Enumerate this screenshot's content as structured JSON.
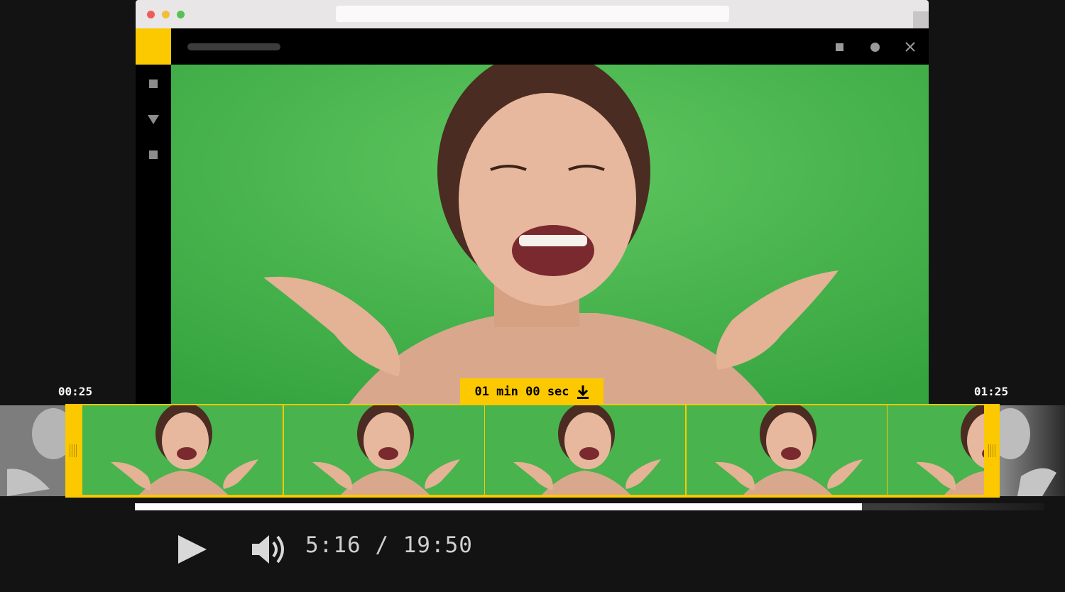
{
  "window": {
    "controls": [
      "close-dot",
      "minimize-dot",
      "maximize-dot"
    ]
  },
  "colors": {
    "accent": "#fcc800",
    "green_screen": "#3fb04a",
    "background": "#131313"
  },
  "timeline": {
    "start_time": "00:25",
    "end_time": "01:25",
    "clip_duration": "01 min 00 sec",
    "frame_count": 5
  },
  "player": {
    "progress": 0.8,
    "current_time": "5:16",
    "separator": "/",
    "total_time": "19:50",
    "time_readout": "5:16 / 19:50"
  },
  "icons": {
    "download": "download-icon",
    "play": "play-icon",
    "volume": "volume-icon"
  }
}
